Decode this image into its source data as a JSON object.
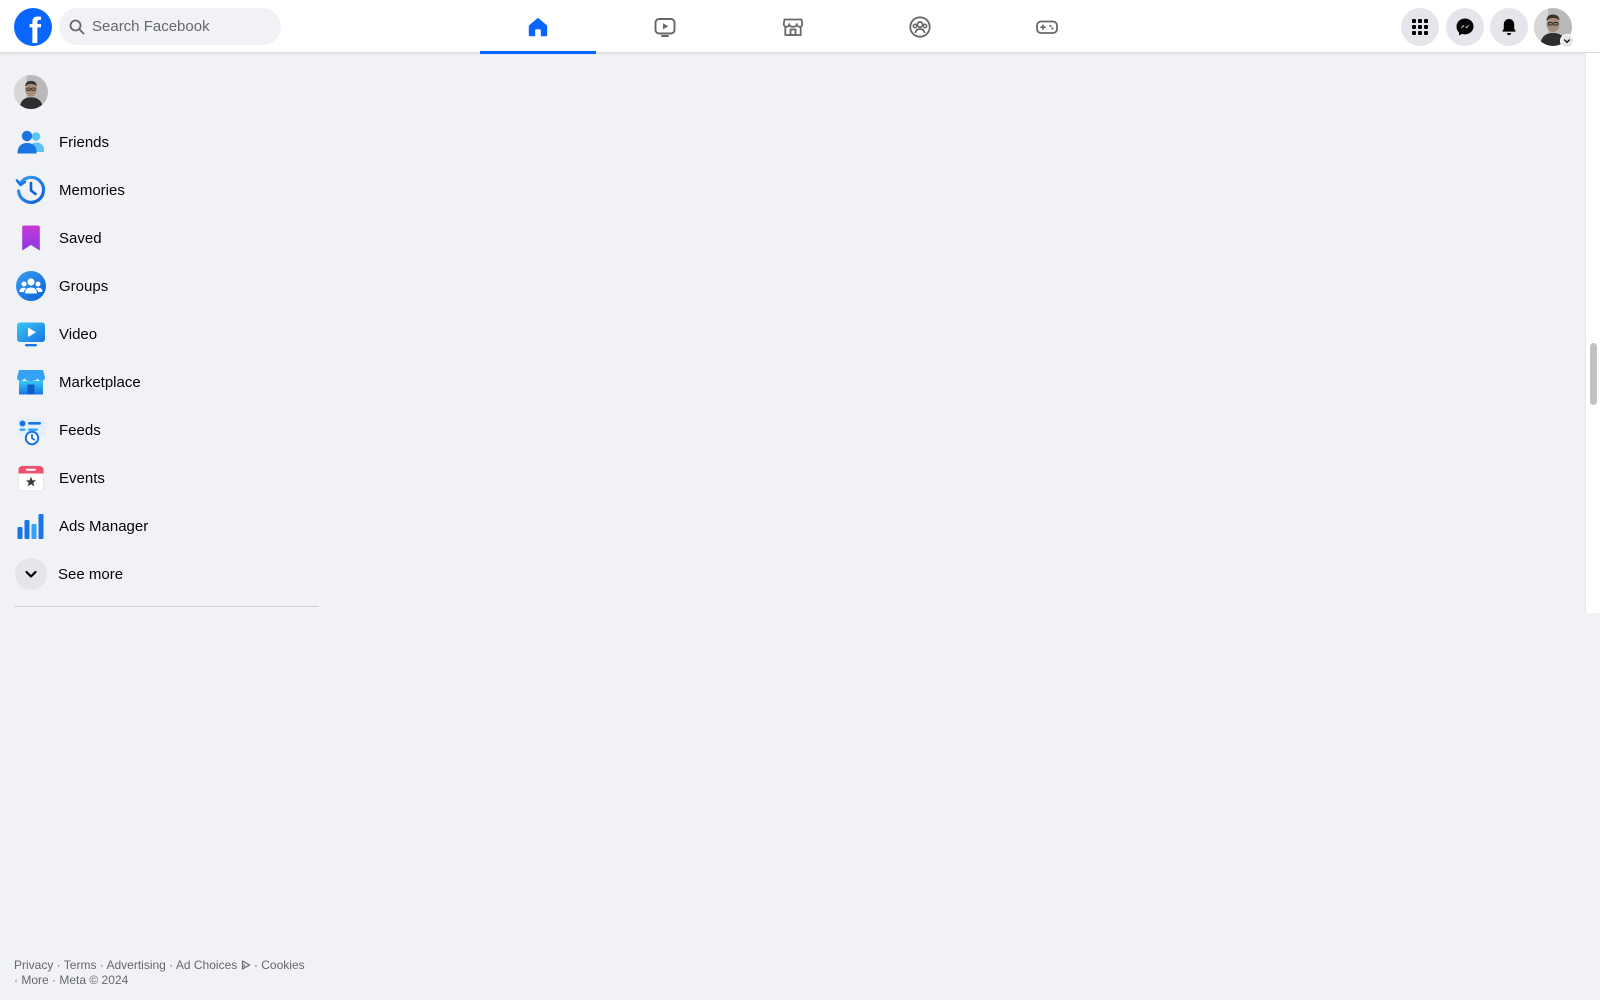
{
  "header": {
    "logo_letter": "f",
    "search": {
      "placeholder": "Search Facebook",
      "value": ""
    },
    "nav_tabs": [
      {
        "name": "Home",
        "icon": "home-icon",
        "active": true
      },
      {
        "name": "Video",
        "icon": "video-icon",
        "active": false
      },
      {
        "name": "Marketplace",
        "icon": "marketplace-icon",
        "active": false
      },
      {
        "name": "Groups",
        "icon": "groups-icon",
        "active": false
      },
      {
        "name": "Gaming",
        "icon": "gaming-icon",
        "active": false
      }
    ],
    "right_buttons": [
      "menu-grid-icon",
      "messenger-icon",
      "notifications-bell-icon",
      "account-avatar"
    ],
    "accent_color": "#0866ff"
  },
  "sidebar": {
    "items": [
      {
        "label": "Friends",
        "icon": "friends-icon"
      },
      {
        "label": "Memories",
        "icon": "memories-clock-icon"
      },
      {
        "label": "Saved",
        "icon": "saved-bookmark-icon"
      },
      {
        "label": "Groups",
        "icon": "groups-icon"
      },
      {
        "label": "Video",
        "icon": "video-icon"
      },
      {
        "label": "Marketplace",
        "icon": "marketplace-icon"
      },
      {
        "label": "Feeds",
        "icon": "feeds-icon"
      },
      {
        "label": "Events",
        "icon": "events-calendar-icon"
      },
      {
        "label": "Ads Manager",
        "icon": "ads-manager-bars-icon"
      }
    ],
    "see_more": "See more"
  },
  "footer": {
    "links": [
      "Privacy",
      "Terms",
      "Advertising",
      "Ad Choices",
      "Cookies",
      "More"
    ],
    "separator": " · ",
    "copyright": "Meta © 2024"
  }
}
